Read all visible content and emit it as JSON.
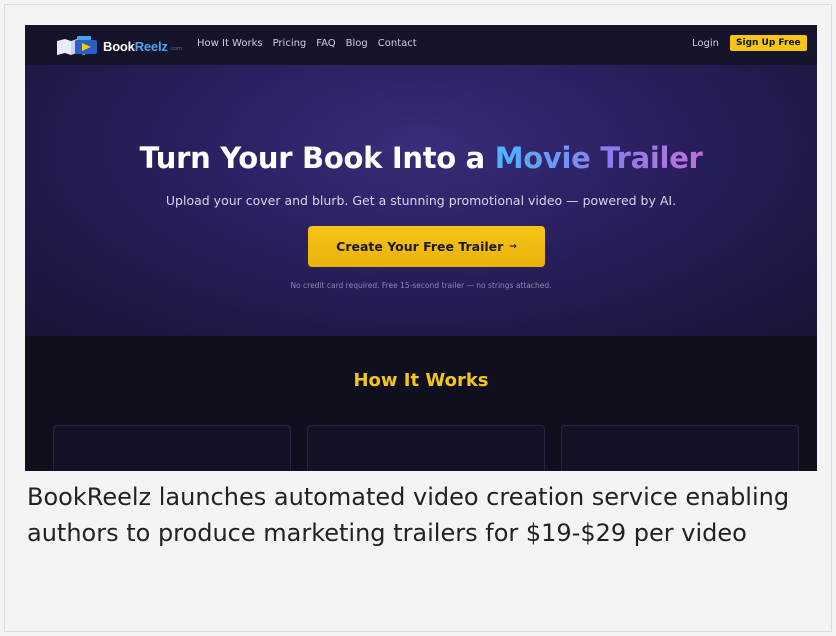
{
  "nav": {
    "logo": {
      "name": "Book",
      "accent": "Reelz",
      "tld": ".com"
    },
    "links": [
      "How It Works",
      "Pricing",
      "FAQ",
      "Blog",
      "Contact"
    ],
    "login": "Login",
    "signup": "Sign Up Free"
  },
  "hero": {
    "title_plain": "Turn Your Book Into a ",
    "title_highlight": "Movie Trailer",
    "subtitle": "Upload your cover and blurb. Get a stunning promotional video — powered by AI.",
    "cta_label": "Create Your Free Trailer",
    "cta_arrow": "→",
    "fine_print": "No credit card required. Free 15-second trailer — no strings attached."
  },
  "how_it_works": {
    "title": "How It Works"
  },
  "caption": "BookReelz launches automated video creation service enabling authors to produce marketing trailers for $19-$29 per video",
  "colors": {
    "accent_yellow": "#f5c518",
    "nav_bg": "#15142a",
    "hero_bg": "#2a2060",
    "gradient_blue": "#4cb6ff",
    "gradient_purple": "#c070d8"
  }
}
